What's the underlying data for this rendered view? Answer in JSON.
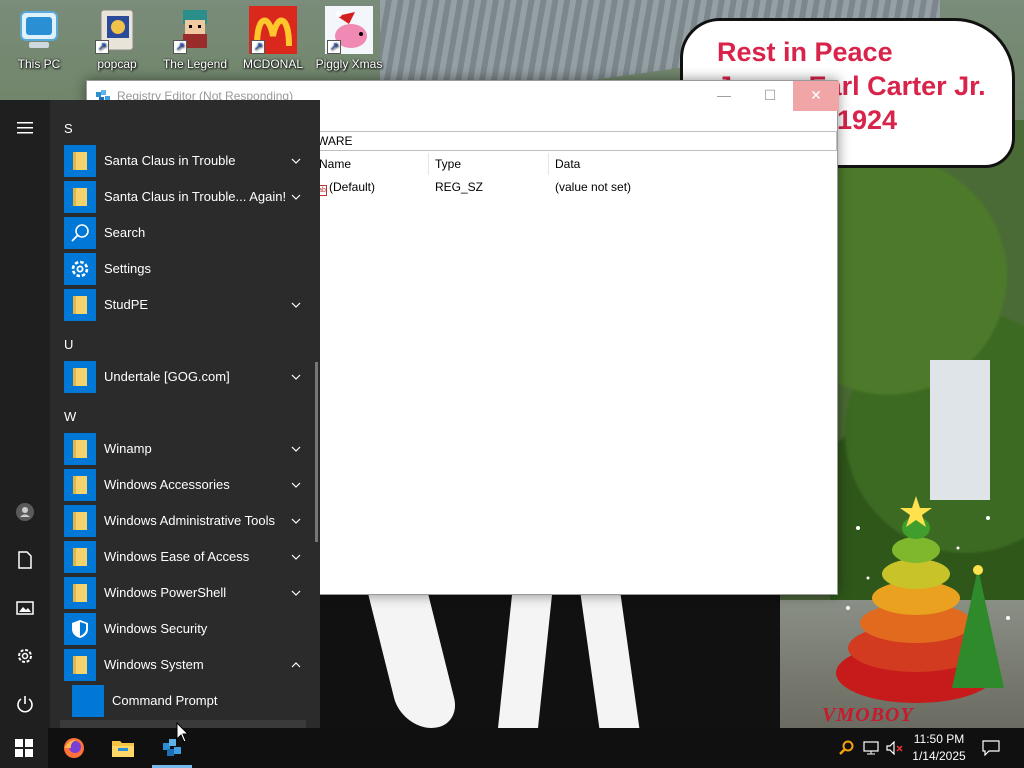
{
  "desktop": {
    "icons": [
      {
        "label": "This PC",
        "icon": "computer-icon"
      },
      {
        "label": "popcap",
        "icon": "popcap-icon"
      },
      {
        "label": "The Legend",
        "icon": "game-character-icon"
      },
      {
        "label": "MCDONAL",
        "icon": "mcdonalds-icon"
      },
      {
        "label": "Piggly Xmas",
        "icon": "pig-icon"
      }
    ],
    "wallpaper_banner": {
      "line1": "Rest in Peace",
      "line2": "James Earl Carter Jr.",
      "line3": "1924"
    },
    "watermark": "VMOBOY"
  },
  "registry_editor": {
    "title": "Registry Editor (Not Responding)",
    "address": "WARE",
    "columns": {
      "name": "Name",
      "type": "Type",
      "data": "Data"
    },
    "rows": [
      {
        "name": "(Default)",
        "type": "REG_SZ",
        "data": "(value not set)"
      }
    ],
    "controls": {
      "minimize": "—",
      "maximize": "☐",
      "close": "✕"
    }
  },
  "start_menu": {
    "sections": [
      {
        "letter": "S",
        "apps": [
          {
            "label": "Santa Claus in Trouble",
            "icon": "folder-icon",
            "expandable": true
          },
          {
            "label": "Santa Claus in Trouble... Again!",
            "icon": "folder-icon",
            "expandable": true
          },
          {
            "label": "Search",
            "icon": "search-icon",
            "expandable": false
          },
          {
            "label": "Settings",
            "icon": "gear-icon",
            "expandable": false
          },
          {
            "label": "StudPE",
            "icon": "folder-icon",
            "expandable": true
          }
        ]
      },
      {
        "letter": "U",
        "apps": [
          {
            "label": "Undertale [GOG.com]",
            "icon": "folder-icon",
            "expandable": true
          }
        ]
      },
      {
        "letter": "W",
        "apps": [
          {
            "label": "Winamp",
            "icon": "folder-icon",
            "expandable": true
          },
          {
            "label": "Windows Accessories",
            "icon": "folder-icon",
            "expandable": true
          },
          {
            "label": "Windows Administrative Tools",
            "icon": "folder-icon",
            "expandable": true
          },
          {
            "label": "Windows Ease of Access",
            "icon": "folder-icon",
            "expandable": true
          },
          {
            "label": "Windows PowerShell",
            "icon": "folder-icon",
            "expandable": true
          },
          {
            "label": "Windows Security",
            "icon": "shield-icon",
            "expandable": false
          },
          {
            "label": "Windows System",
            "icon": "folder-icon",
            "expandable": true,
            "expanded": true
          }
        ]
      }
    ],
    "sub_items": [
      {
        "label": "Command Prompt",
        "icon": "command-prompt-icon"
      }
    ],
    "rail": [
      "hamburger-icon",
      "user-icon",
      "documents-icon",
      "pictures-icon",
      "gear-icon",
      "power-icon"
    ]
  },
  "taskbar": {
    "pinned": [
      "windows-start-icon",
      "firefox-icon",
      "file-explorer-icon",
      "registry-editor-icon"
    ],
    "tray": [
      "search-tray-icon",
      "network-icon",
      "volume-muted-icon"
    ],
    "time": "11:50 PM",
    "date": "1/14/2025",
    "notification": "notification-icon"
  },
  "colors": {
    "accent": "#0078d7",
    "start_bg": "#2b2b2b",
    "taskbar_bg": "#101010",
    "banner_text": "#d8234a"
  }
}
